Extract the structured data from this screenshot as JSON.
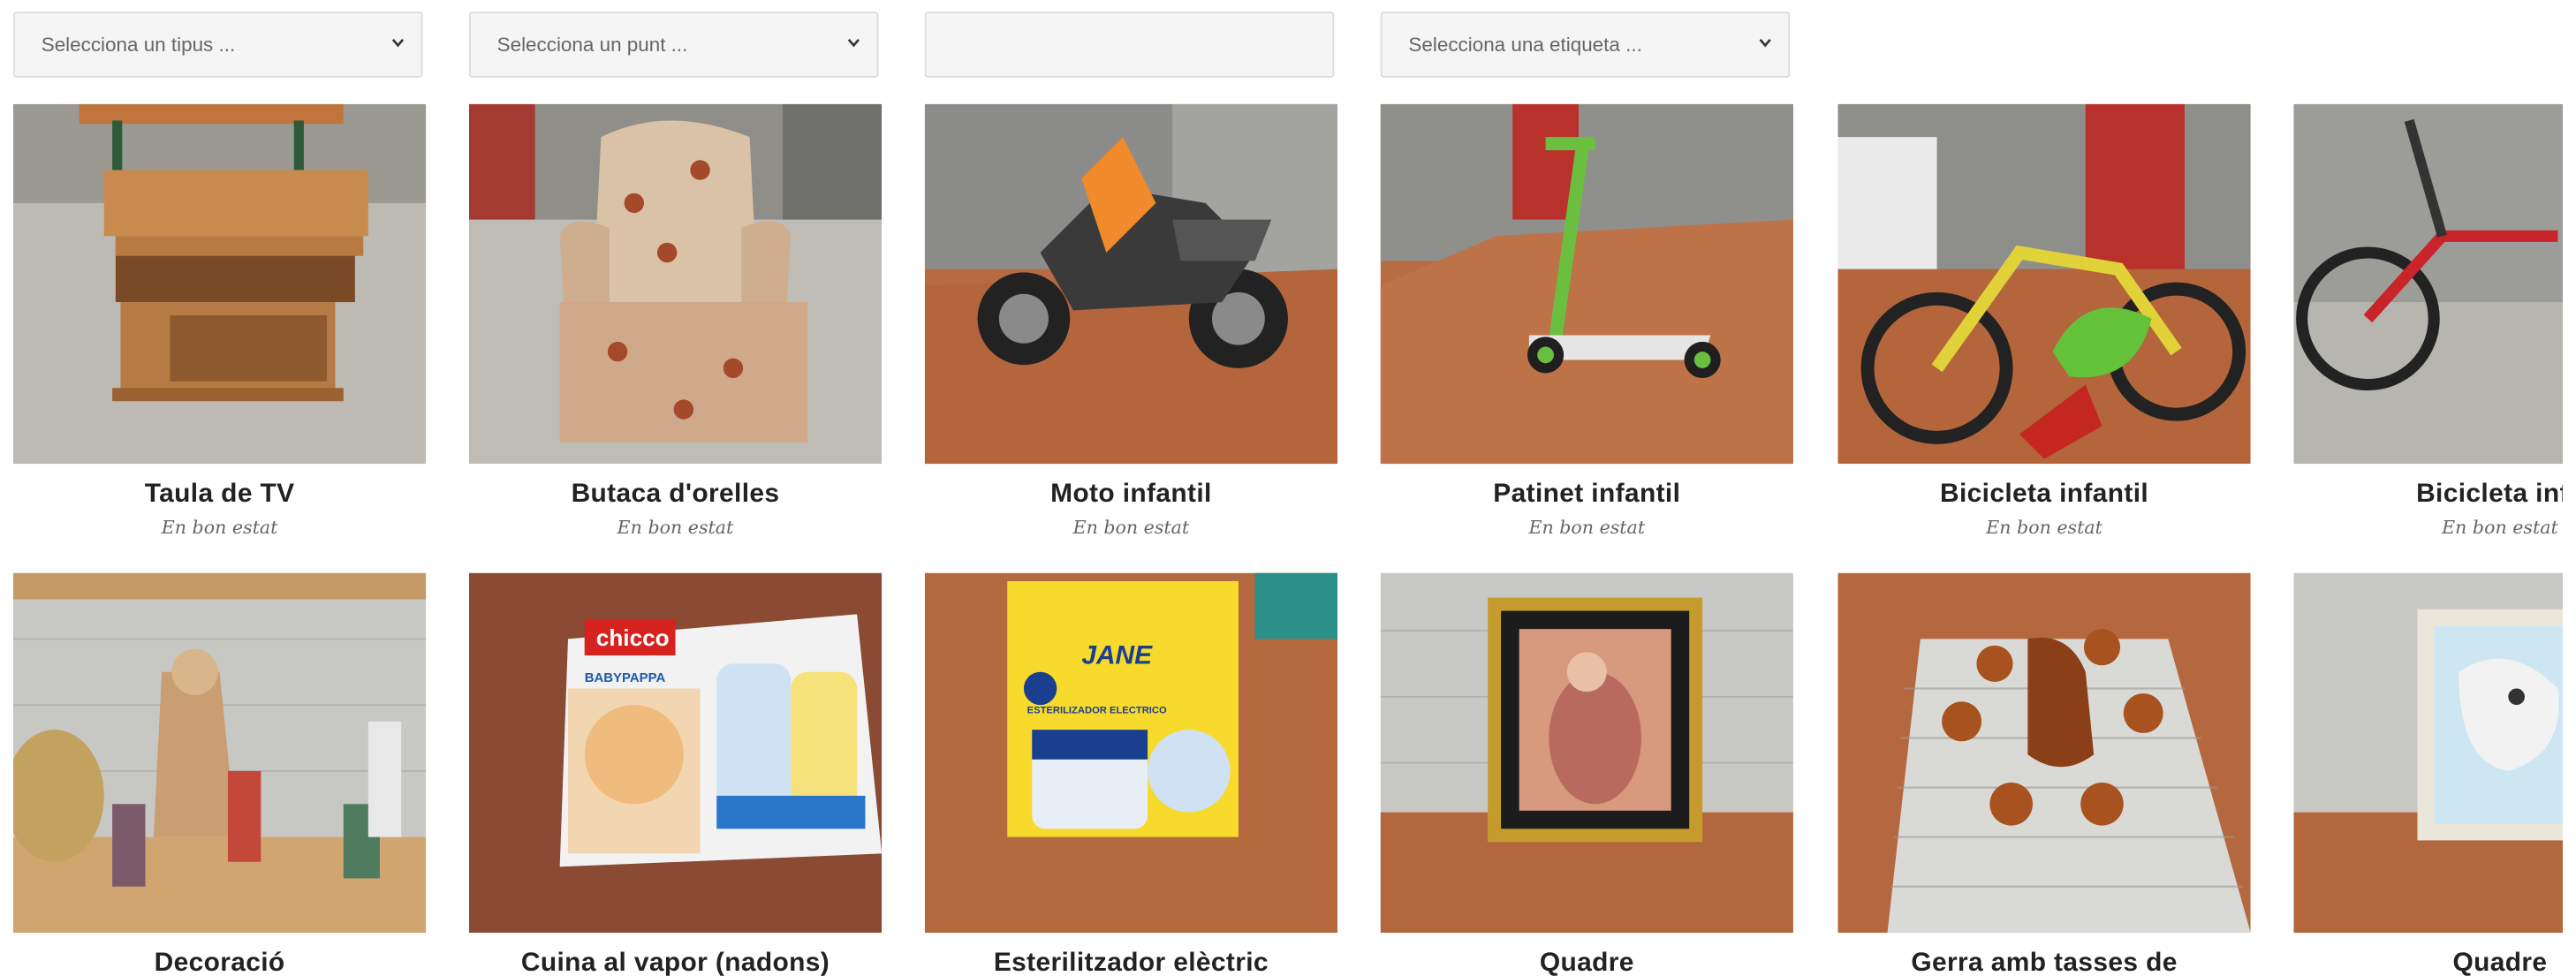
{
  "filters": {
    "type_placeholder": "Selecciona un tipus ...",
    "point_placeholder": "Selecciona un punt ...",
    "search_value": "",
    "tag_placeholder": "Selecciona una etiqueta ..."
  },
  "items": [
    {
      "title": "Taula de TV",
      "subtitle": "En bon estat"
    },
    {
      "title": "Butaca d'orelles",
      "subtitle": "En bon estat"
    },
    {
      "title": "Moto infantil",
      "subtitle": "En bon estat"
    },
    {
      "title": "Patinet infantil",
      "subtitle": "En bon estat"
    },
    {
      "title": "Bicicleta infantil",
      "subtitle": "En bon estat"
    },
    {
      "title": "Bicicleta infa",
      "subtitle": "En bon estat"
    },
    {
      "title": "Decoració",
      "subtitle": ""
    },
    {
      "title": "Cuina al vapor (nadons)",
      "subtitle": ""
    },
    {
      "title": "Esterilitzador elèctric",
      "subtitle": ""
    },
    {
      "title": "Quadre",
      "subtitle": ""
    },
    {
      "title": "Gerra amb tasses de",
      "subtitle": ""
    },
    {
      "title": "Quadre",
      "subtitle": ""
    }
  ],
  "product_labels": {
    "chicco": "chicco",
    "babypappa": "BABYPAPPA",
    "jane": "JANE",
    "esterilizador": "ESTERILIZADOR ELECTRICO"
  },
  "colors": {
    "floor_grey": "#b9b6ae",
    "table_brown": "#b0633b",
    "wall_grey": "#c9c9c6"
  }
}
